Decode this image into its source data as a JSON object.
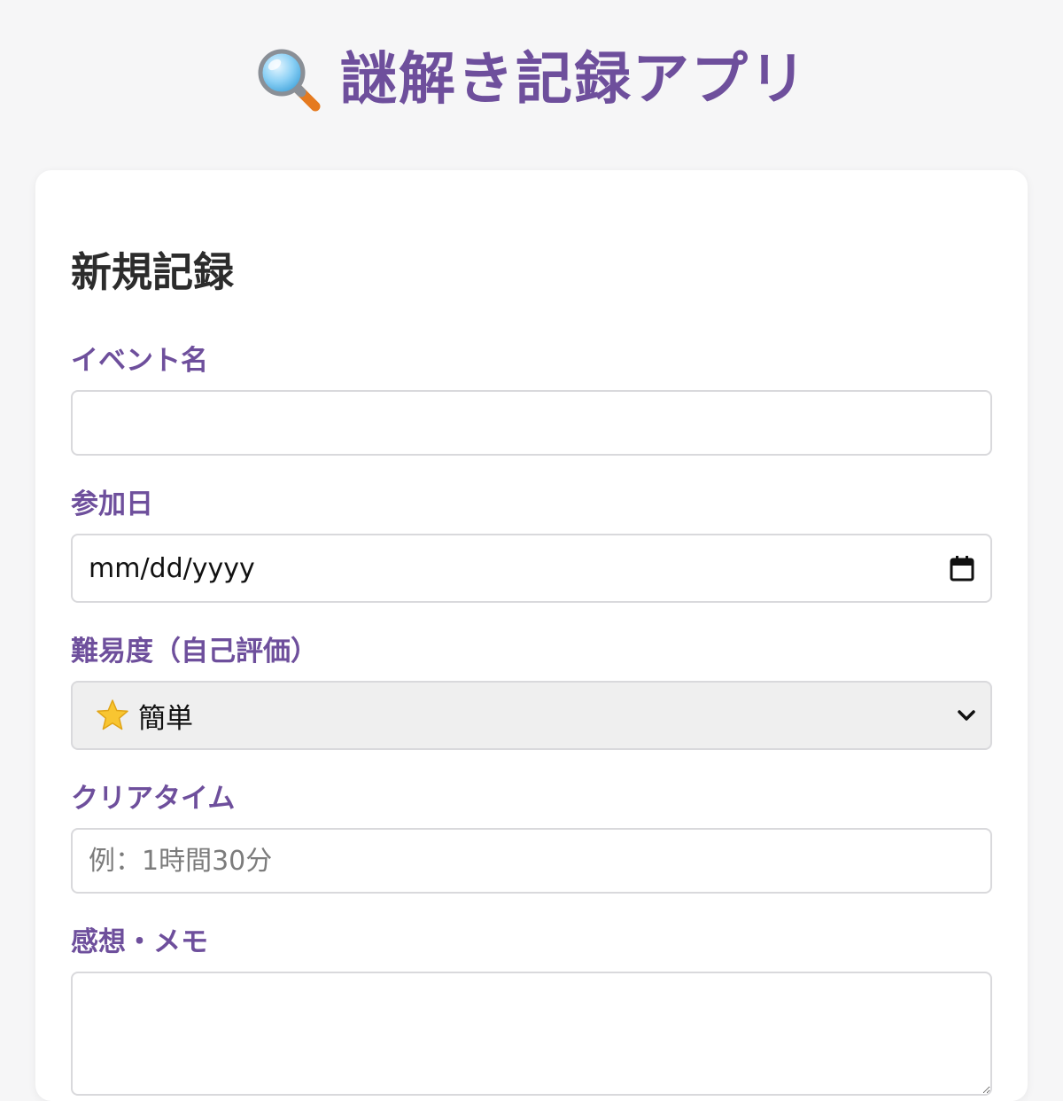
{
  "header": {
    "icon": "magnifying-glass-icon",
    "title": "謎解き記録アプリ"
  },
  "form": {
    "section_title": "新規記録",
    "event_name": {
      "label": "イベント名",
      "value": "",
      "placeholder": ""
    },
    "date": {
      "label": "参加日",
      "value": "mm/dd/yyyy",
      "icon": "calendar-icon"
    },
    "difficulty": {
      "label": "難易度（自己評価）",
      "selected_icon": "star-icon",
      "selected": "簡単",
      "chevron": "chevron-down-icon"
    },
    "clear_time": {
      "label": "クリアタイム",
      "value": "",
      "placeholder": "例：1時間30分"
    },
    "memo": {
      "label": "感想・メモ",
      "value": ""
    }
  },
  "colors": {
    "accent": "#6e4f9c",
    "background": "#f6f6f7",
    "card": "#ffffff",
    "border": "#d9d9dc",
    "select_bg": "#efefef"
  }
}
